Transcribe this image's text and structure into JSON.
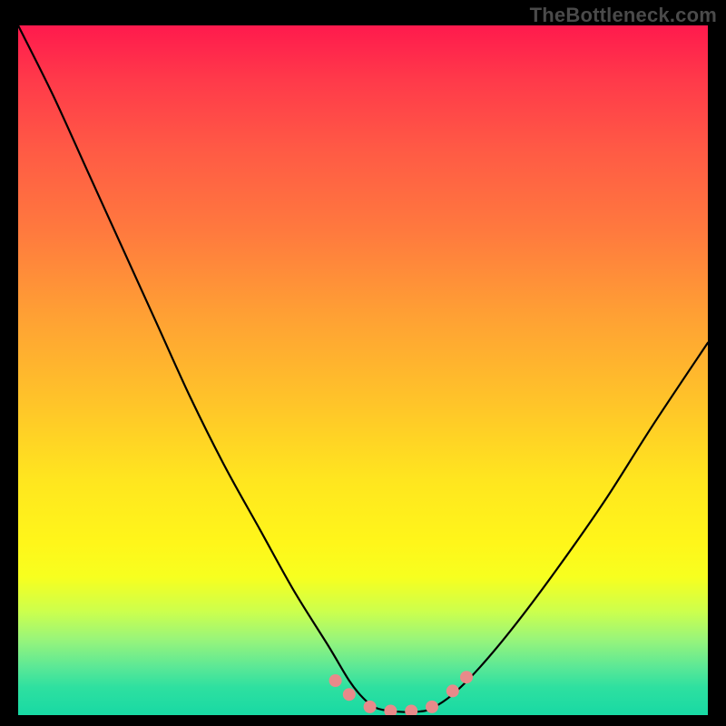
{
  "watermark": "TheBottleneck.com",
  "colors": {
    "frame": "#000000",
    "marker": "#e88a8a",
    "curve": "#000000",
    "gradient_top": "#ff1a4d",
    "gradient_bottom": "#18d9a4"
  },
  "chart_data": {
    "type": "line",
    "title": "",
    "xlabel": "",
    "ylabel": "",
    "xlim": [
      0,
      100
    ],
    "ylim": [
      0,
      100
    ],
    "grid": false,
    "legend": false,
    "annotations": [
      "TheBottleneck.com"
    ],
    "series": [
      {
        "name": "bottleneck-curve",
        "x": [
          0,
          5,
          10,
          15,
          20,
          25,
          30,
          35,
          40,
          45,
          48,
          50,
          52,
          55,
          58,
          60,
          63,
          67,
          72,
          78,
          85,
          92,
          100
        ],
        "y": [
          100,
          90,
          79,
          68,
          57,
          46,
          36,
          27,
          18,
          10,
          5,
          2.5,
          1,
          0.5,
          0.5,
          1,
          3,
          7,
          13,
          21,
          31,
          42,
          54
        ]
      }
    ],
    "markers": [
      {
        "x": 46,
        "y": 5.0
      },
      {
        "x": 48,
        "y": 3.0
      },
      {
        "x": 51,
        "y": 1.2
      },
      {
        "x": 54,
        "y": 0.6
      },
      {
        "x": 57,
        "y": 0.6
      },
      {
        "x": 60,
        "y": 1.2
      },
      {
        "x": 63,
        "y": 3.5
      },
      {
        "x": 65,
        "y": 5.5
      }
    ]
  }
}
